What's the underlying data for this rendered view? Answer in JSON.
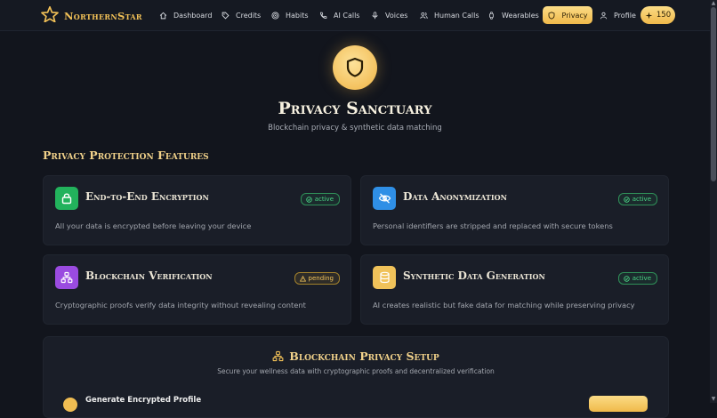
{
  "brand": {
    "name": "NorthernStar",
    "icon": "star-icon"
  },
  "nav": {
    "items": [
      {
        "label": "Dashboard",
        "icon": "home-icon"
      },
      {
        "label": "Credits",
        "icon": "tag-icon"
      },
      {
        "label": "Habits",
        "icon": "target-icon"
      },
      {
        "label": "AI Calls",
        "icon": "phone-icon"
      },
      {
        "label": "Voices",
        "icon": "mic-icon"
      },
      {
        "label": "Human Calls",
        "icon": "users-icon"
      },
      {
        "label": "Wearables",
        "icon": "watch-icon"
      },
      {
        "label": "Privacy",
        "icon": "shield-icon",
        "active": true
      },
      {
        "label": "Profile",
        "icon": "user-icon"
      }
    ],
    "credits": "150"
  },
  "hero": {
    "title": "Privacy Sanctuary",
    "subtitle": "Blockchain privacy & synthetic data matching"
  },
  "features": {
    "title": "Privacy Protection Features",
    "cards": [
      {
        "title": "End-to-End Encryption",
        "description": "All your data is encrypted before leaving your device",
        "status": "active",
        "icon": "lock-icon",
        "color": "#22b25c"
      },
      {
        "title": "Data Anonymization",
        "description": "Personal identifiers are stripped and replaced with secure tokens",
        "status": "active",
        "icon": "eye-off-icon",
        "color": "#2f8fe6"
      },
      {
        "title": "Blockchain Verification",
        "description": "Cryptographic proofs verify data integrity without revealing content",
        "status": "pending",
        "icon": "network-icon",
        "color": "#9a4be0"
      },
      {
        "title": "Synthetic Data Generation",
        "description": "AI creates realistic but fake data for matching while preserving privacy",
        "status": "active",
        "icon": "database-icon",
        "color": "#f0c25a"
      }
    ]
  },
  "setup": {
    "title": "Blockchain Privacy Setup",
    "subtitle": "Secure your wellness data with cryptographic proofs and decentralized verification",
    "step_label": "Generate Encrypted Profile"
  },
  "colors": {
    "accent": "#f0b94a",
    "background": "#12151d",
    "card": "#1a1e28",
    "active": "#4ad385",
    "pending": "#f2c45a"
  }
}
